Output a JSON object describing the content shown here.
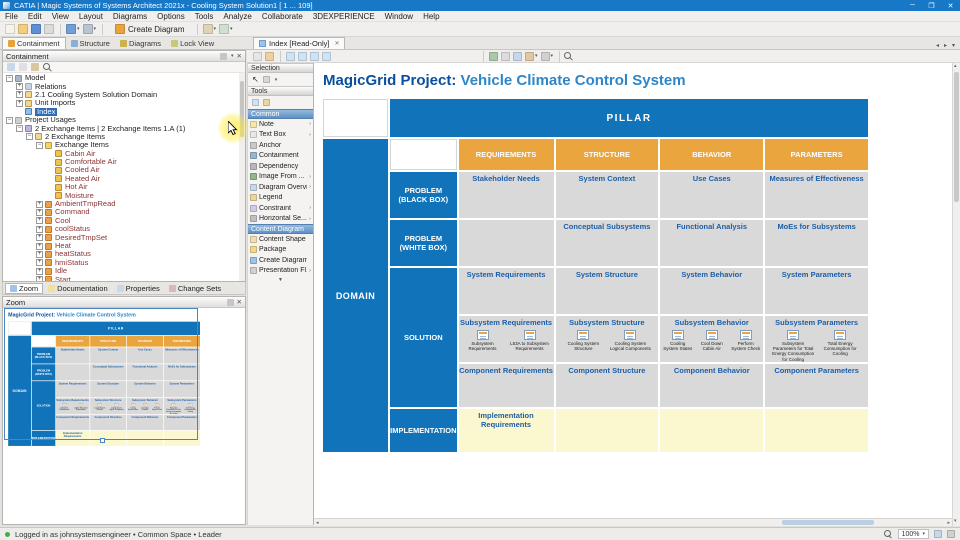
{
  "window": {
    "title": "CATIA | Magic Systems of Systems Architect 2021x - Cooling System Solution1 [ 1 ... 109]",
    "minimize": "─",
    "maximize": "❐",
    "close": "✕"
  },
  "menubar": [
    "File",
    "Edit",
    "View",
    "Layout",
    "Diagrams",
    "Options",
    "Tools",
    "Analyze",
    "Collaborate",
    "3DEXPERIENCE",
    "Window",
    "Help"
  ],
  "main_toolbar": {
    "create_diagram_label": "Create Diagram",
    "group1": [
      {
        "name": "new-project-icon",
        "bg": "#f7f3e8"
      },
      {
        "name": "open-project-icon",
        "bg": "#f2cf7a"
      },
      {
        "name": "save-icon",
        "bg": "#5b8fd6"
      },
      {
        "name": "print-icon",
        "bg": "#dcdcdc"
      }
    ],
    "group2": [
      {
        "name": "undo-icon",
        "bg": "#6f9fd8",
        "dd": true
      },
      {
        "name": "redo-icon",
        "bg": "#b8c4d0",
        "dd": true
      }
    ],
    "group3": [
      {
        "name": "validation-icon",
        "bg": "#e0d4b8",
        "dd": true
      },
      {
        "name": "perspective-icon",
        "bg": "#cfe0d0",
        "dd": true
      }
    ]
  },
  "perspective_tabs": [
    {
      "label": "Containment",
      "bg": "#e8a33d",
      "cls": "active",
      "name": "tab-containment"
    },
    {
      "label": "Structure",
      "bg": "#8aaed6",
      "name": "tab-structure"
    },
    {
      "label": "Diagrams",
      "bg": "#c8b44b",
      "name": "tab-diagrams"
    },
    {
      "label": "Lock View",
      "bg": "#c8c87a",
      "name": "tab-lock-view"
    }
  ],
  "containment_panel": {
    "title": "Containment",
    "tree": [
      {
        "label": "Model",
        "ind": 3,
        "exp": "minus",
        "icon": "i-model",
        "name": "tree-item-model"
      },
      {
        "label": "Relations",
        "ind": 13,
        "exp": "plus",
        "icon": "i-rel",
        "name": "tree-item-relations"
      },
      {
        "label": "2.1 Cooling System Solution Domain",
        "ind": 13,
        "exp": "plus",
        "icon": "i-pkg",
        "name": "tree-item-cooling-system-solution-domain"
      },
      {
        "label": "Unit Imports",
        "ind": 13,
        "exp": "plus",
        "icon": "i-pkg",
        "name": "tree-item-unit-imports"
      },
      {
        "label": "Index",
        "ind": 13,
        "exp": "none",
        "icon": "i-dgm",
        "cls": "sel",
        "name": "tree-item-index"
      },
      {
        "label": "Project Usages",
        "ind": 3,
        "exp": "minus",
        "icon": "i-root",
        "name": "tree-item-project-usages"
      },
      {
        "label": "2 Exchange Items | 2 Exchange Items 1.A (1)",
        "ind": 13,
        "exp": "minus",
        "icon": "i-proj",
        "name": "tree-item-exchange-items-usage"
      },
      {
        "label": "2 Exchange Items",
        "ind": 23,
        "exp": "minus",
        "icon": "i-pkg",
        "name": "tree-item-2-exchange-items"
      },
      {
        "label": "Exchange Items",
        "ind": 33,
        "exp": "minus",
        "icon": "i-pkgy",
        "name": "tree-item-exchange-items"
      },
      {
        "label": "Cabin Air",
        "ind": 43,
        "exp": "none",
        "icon": "i-flow",
        "cls": "red"
      },
      {
        "label": "Comfortable Air",
        "ind": 43,
        "exp": "none",
        "icon": "i-flow",
        "cls": "red"
      },
      {
        "label": "Cooled Air",
        "ind": 43,
        "exp": "none",
        "icon": "i-flow",
        "cls": "red"
      },
      {
        "label": "Heated Air",
        "ind": 43,
        "exp": "none",
        "icon": "i-flow",
        "cls": "red"
      },
      {
        "label": "Hot Air",
        "ind": 43,
        "exp": "none",
        "icon": "i-flow",
        "cls": "red"
      },
      {
        "label": "Moisture",
        "ind": 43,
        "exp": "none",
        "icon": "i-flow",
        "cls": "red"
      },
      {
        "label": "AmbientTmpRead",
        "ind": 33,
        "exp": "plus",
        "icon": "i-sig",
        "cls": "red"
      },
      {
        "label": "Command",
        "ind": 33,
        "exp": "plus",
        "icon": "i-sig",
        "cls": "red"
      },
      {
        "label": "Cool",
        "ind": 33,
        "exp": "plus",
        "icon": "i-sig",
        "cls": "red"
      },
      {
        "label": "coolStatus",
        "ind": 33,
        "exp": "plus",
        "icon": "i-sig",
        "cls": "red"
      },
      {
        "label": "DesiredTmpSet",
        "ind": 33,
        "exp": "plus",
        "icon": "i-sig",
        "cls": "red"
      },
      {
        "label": "Heat",
        "ind": 33,
        "exp": "plus",
        "icon": "i-sig",
        "cls": "red"
      },
      {
        "label": "heatStatus",
        "ind": 33,
        "exp": "plus",
        "icon": "i-sig",
        "cls": "red"
      },
      {
        "label": "hmiStatus",
        "ind": 33,
        "exp": "plus",
        "icon": "i-sig",
        "cls": "red"
      },
      {
        "label": "Idle",
        "ind": 33,
        "exp": "plus",
        "icon": "i-sig",
        "cls": "red"
      },
      {
        "label": "Start",
        "ind": 33,
        "exp": "plus",
        "icon": "i-sig",
        "cls": "red"
      }
    ]
  },
  "bottom_tabs": [
    {
      "label": "Zoom",
      "bg": "#9cc3e8",
      "cls": "active",
      "name": "tab-zoom"
    },
    {
      "label": "Documentation",
      "bg": "#f0e0a0",
      "name": "tab-documentation"
    },
    {
      "label": "Properties",
      "bg": "#c8d8ea",
      "name": "tab-properties"
    },
    {
      "label": "Change Sets",
      "bg": "#d8b8b8",
      "name": "tab-change-sets"
    }
  ],
  "zoom_panel": {
    "title": "Zoom"
  },
  "diagram_tabbar": {
    "tab_label": "Index [Read-Only]",
    "close": "✕"
  },
  "diagram_toolbar": {
    "groupA": [
      {
        "name": "selection-mode-icon",
        "bg": "#e6e6e6"
      },
      {
        "name": "pan-icon",
        "bg": "#f0d0a0"
      }
    ],
    "groupB": [
      {
        "name": "zoom-fit-icon",
        "bg": "#cfe3f5"
      },
      {
        "name": "zoom-in-icon",
        "bg": "#cfe3f5"
      },
      {
        "name": "zoom-out-icon",
        "bg": "#cfe3f5"
      },
      {
        "name": "zoom-selection-icon",
        "bg": "#cfe3f5"
      }
    ],
    "groupC": [
      {
        "name": "export-image-icon",
        "bg": "#a8c8a8"
      },
      {
        "name": "print-diagram-icon",
        "bg": "#dcdcdc"
      },
      {
        "name": "show-grid-icon",
        "bg": "#c8d8ea"
      },
      {
        "name": "layers-icon",
        "bg": "#e0c8a0",
        "dd": true
      },
      {
        "name": "diagram-options-icon",
        "bg": "#d0d0d0",
        "dd": true
      }
    ]
  },
  "palette": {
    "selection_header": "Selection",
    "tools_header": "Tools",
    "common_header": "Common",
    "content_header": "Content Diagram",
    "more": "▼",
    "pointer_glyph": "↖",
    "common_items": [
      {
        "label": "Note",
        "chev": true,
        "bg": "#f5e9a8"
      },
      {
        "label": "Text Box",
        "chev": true,
        "bg": "#e8e8e8"
      },
      {
        "label": "Anchor",
        "bg": "#c9c9c9"
      },
      {
        "label": "Containment",
        "bg": "#9ab5d0"
      },
      {
        "label": "Dependency",
        "bg": "#b8b8b8"
      },
      {
        "label": "Image From ...",
        "chev": true,
        "bg": "#8fb88f"
      },
      {
        "label": "Diagram Overvi...",
        "chev": true,
        "bg": "#c8d8ea"
      },
      {
        "label": "Legend",
        "bg": "#e8d8a0"
      },
      {
        "label": "Constraint",
        "chev": true,
        "bg": "#d8c8e8"
      },
      {
        "label": "Horizontal Se...",
        "chev": true,
        "bg": "#c0c0c0"
      }
    ],
    "content_items": [
      {
        "label": "Content Shape",
        "bg": "#f0e0b0"
      },
      {
        "label": "Package",
        "bg": "#f2d98a"
      },
      {
        "label": "Create Diagram",
        "bg": "#9cc3e8"
      },
      {
        "label": "Presentation Fl...",
        "chev": true,
        "bg": "#d0d0d0"
      }
    ]
  },
  "diagram": {
    "title_bold": "MagicGrid Project:",
    "title_rest": " Vehicle Climate Control System",
    "grid": {
      "pillar": "PILLAR",
      "domain": "DOMAIN",
      "col_headers": [
        "REQUIREMENTS",
        "STRUCTURE",
        "BEHAVIOR",
        "PARAMETERS"
      ],
      "row_labels": {
        "pbb": "PROBLEM\n(BLACK BOX)",
        "pwb": "PROBLEM\n(WHITE BOX)",
        "sol": "SOLUTION",
        "impl": "IMPLEMENTATION"
      },
      "cells": {
        "pbb": [
          "Stakeholder Needs",
          "System Context",
          "Use Cases",
          "Measures of Effectiveness"
        ],
        "pwb": [
          "",
          "Conceptual Subsystems",
          "Functional Analysis",
          "MoEs for Subsystems"
        ],
        "sol_system": [
          "System Requirements",
          "System Structure",
          "System Behavior",
          "System Parameters"
        ],
        "sub_labels": [
          "Subsystem Requirements",
          "Subsystem Structure",
          "Subsystem Behavior",
          "Subsystem Parameters"
        ],
        "sub_req": [
          "Subsystem Requirements",
          "L53A to Subsystem Requirements"
        ],
        "sub_struct": [
          "Cooling System Structure",
          "Cooling System Logical Components"
        ],
        "sub_behav": [
          "Cooling System States",
          "Cool Down Cabin Air",
          "Perform System Check"
        ],
        "sub_param": [
          "Subsystem Parameters for Total Energy Consumption for Cooling",
          "Total Energy Consumption for Cooling"
        ],
        "sol_component": [
          "Component Requirements",
          "Component Structure",
          "Component Behavior",
          "Component Parameters"
        ],
        "impl": [
          "Implementation Requirements",
          "",
          "",
          ""
        ]
      }
    }
  },
  "statusbar": {
    "left": "Logged in as johnsystemsengineer  •  Common Space  •  Leader",
    "zoom_level": "100%"
  }
}
